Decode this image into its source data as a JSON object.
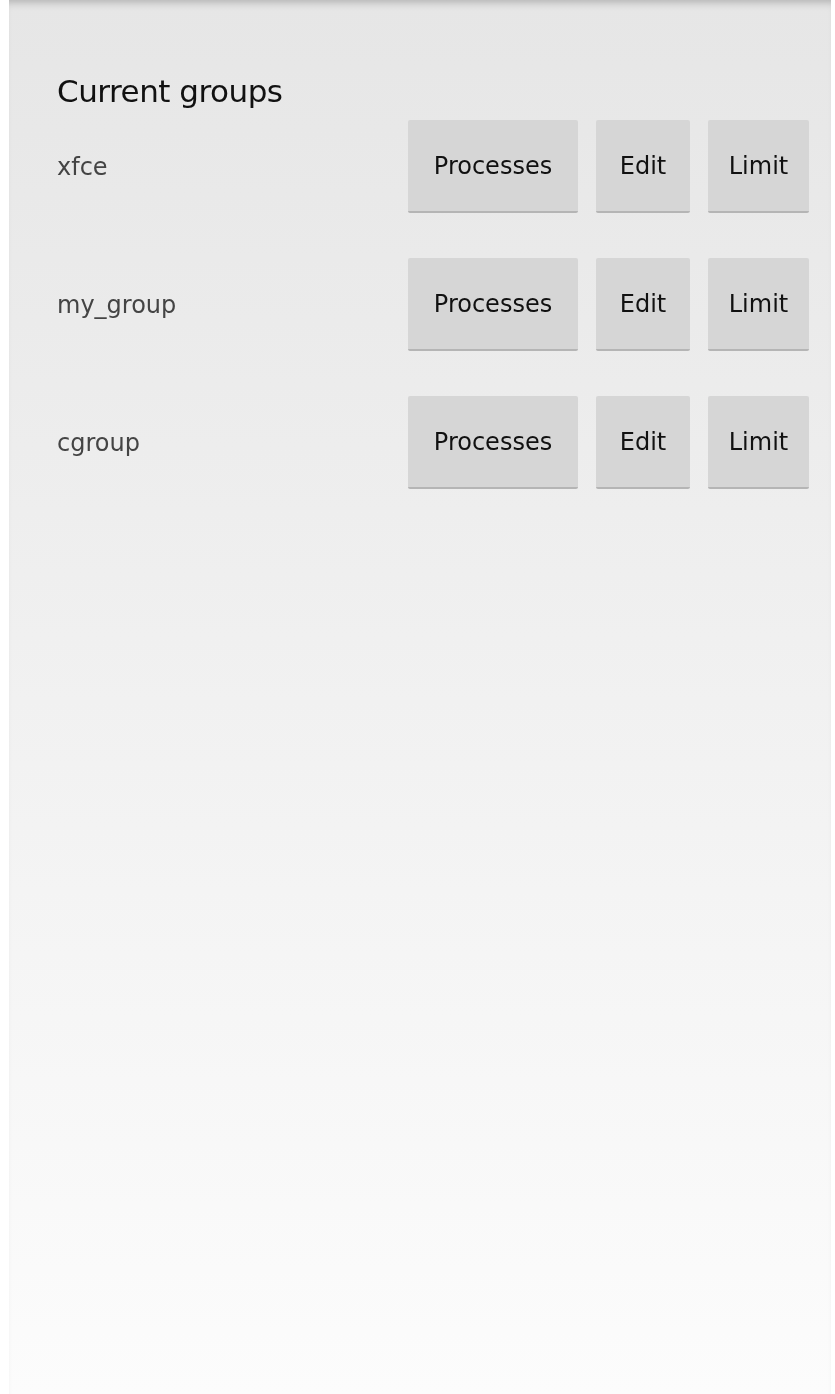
{
  "title": "Current groups",
  "groups": [
    {
      "name": "xfce",
      "buttons": [
        "Processes",
        "Edit",
        "Limit"
      ]
    },
    {
      "name": "my_group",
      "buttons": [
        "Processes",
        "Edit",
        "Limit"
      ]
    },
    {
      "name": "cgroup",
      "buttons": [
        "Processes",
        "Edit",
        "Limit"
      ]
    }
  ]
}
